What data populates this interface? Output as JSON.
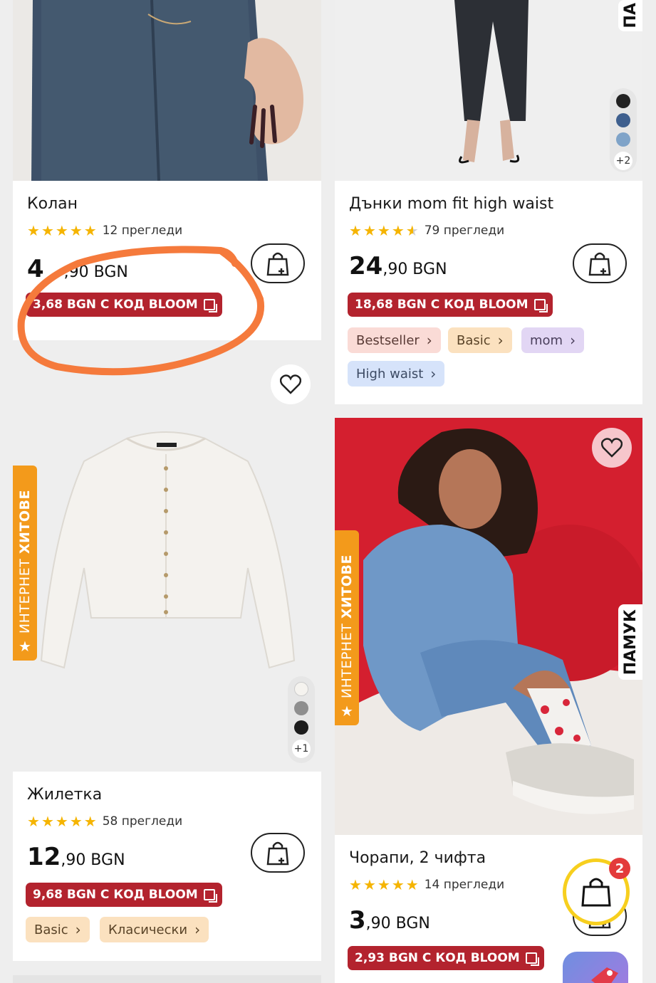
{
  "products": [
    {
      "title": "Колан",
      "reviews": "12 прегледи",
      "price_visible_start": "4",
      "price_visible_end": ",90 BGN",
      "promo": "3,68 BGN С КОД BLOOM",
      "rating": 5
    },
    {
      "title": "Дънки mom fit high waist",
      "reviews": "79 прегледи",
      "price_main": "24",
      "price_rest": ",90 BGN",
      "promo": "18,68 BGN С КОД BLOOM",
      "rating": 4.5,
      "tags": [
        "Bestseller",
        "Basic",
        "mom",
        "High waist"
      ],
      "colors_more": "+2",
      "side_label": "ПА"
    },
    {
      "title": "Жилетка",
      "reviews": "58 прегледи",
      "price_main": "12",
      "price_rest": ",90 BGN",
      "promo": "9,68 BGN С КОД BLOOM",
      "rating": 5,
      "tags": [
        "Basic",
        "Класически"
      ],
      "colors_more": "+1",
      "ribbon_light": "ИНТЕРНЕТ",
      "ribbon_bold": "ХИТОВЕ"
    },
    {
      "title": "Чорапи, 2 чифта",
      "reviews": "14 прегледи",
      "price_main": "3",
      "price_rest": ",90 BGN",
      "promo": "2,93 BGN С КОД BLOOM",
      "rating": 5,
      "ribbon_light": "ИНТЕРНЕТ",
      "ribbon_bold": "ХИТОВЕ",
      "side_label": "ПАМУК"
    }
  ],
  "cart": {
    "count": "2"
  },
  "icons": [
    "cart-add-icon",
    "heart-icon",
    "shopping-bag-icon",
    "copy-icon",
    "star-icon",
    "chevron-right-icon"
  ],
  "colors": {
    "promo": "#b3232e",
    "star": "#f5b400",
    "ribbon": "#f39a1b",
    "annotation": "#f57a3c",
    "cart_ring": "#f7cf1e",
    "badge": "#e33b3b"
  }
}
